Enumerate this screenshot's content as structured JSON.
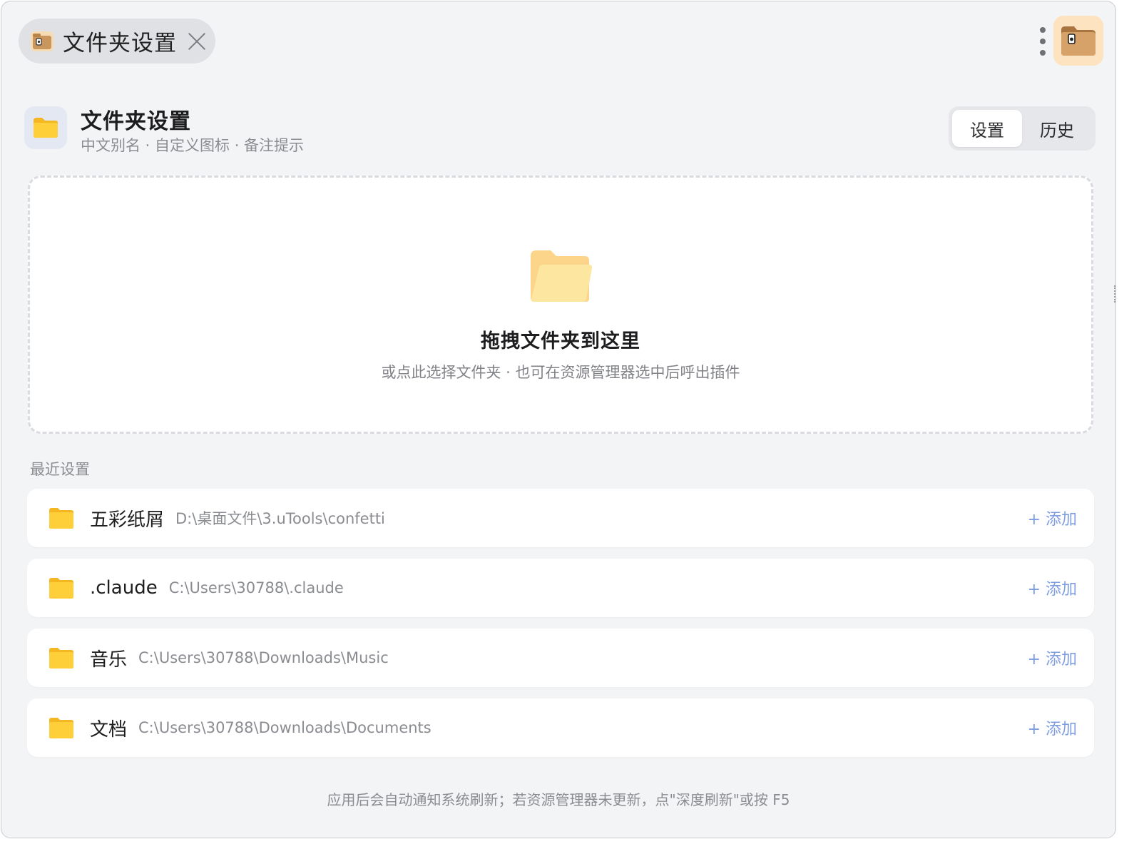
{
  "tab": {
    "title": "文件夹设置"
  },
  "header": {
    "title": "文件夹设置",
    "subtitle": "中文别名 · 自定义图标 · 备注提示"
  },
  "segments": [
    {
      "label": "设置",
      "active": true
    },
    {
      "label": "历史",
      "active": false
    }
  ],
  "dropzone": {
    "title": "拖拽文件夹到这里",
    "hint": "或点此选择文件夹 · 也可在资源管理器选中后呼出插件"
  },
  "recent": {
    "label": "最近设置",
    "items": [
      {
        "name": "五彩纸屑",
        "path": "D:\\桌面文件\\3.uTools\\confetti",
        "action": "+ 添加"
      },
      {
        "name": ".claude",
        "path": "C:\\Users\\30788\\.claude",
        "action": "+ 添加"
      },
      {
        "name": "音乐",
        "path": "C:\\Users\\30788\\Downloads\\Music",
        "action": "+ 添加"
      },
      {
        "name": "文档",
        "path": "C:\\Users\\30788\\Downloads\\Documents",
        "action": "+ 添加"
      }
    ]
  },
  "footer": {
    "text": "应用后会自动通知系统刷新；若资源管理器未更新，点\"深度刷新\"或按 F5"
  },
  "icons": {
    "tab": "app-folder-icon",
    "menu": "more-vertical-icon",
    "logo": "app-logo-icon",
    "header": "folder-icon",
    "dropzone": "open-folder-icon",
    "row": "folder-icon"
  },
  "colors": {
    "accent": "#7f9ee2",
    "folder": "#fcc934",
    "background": "#f3f4f6"
  }
}
